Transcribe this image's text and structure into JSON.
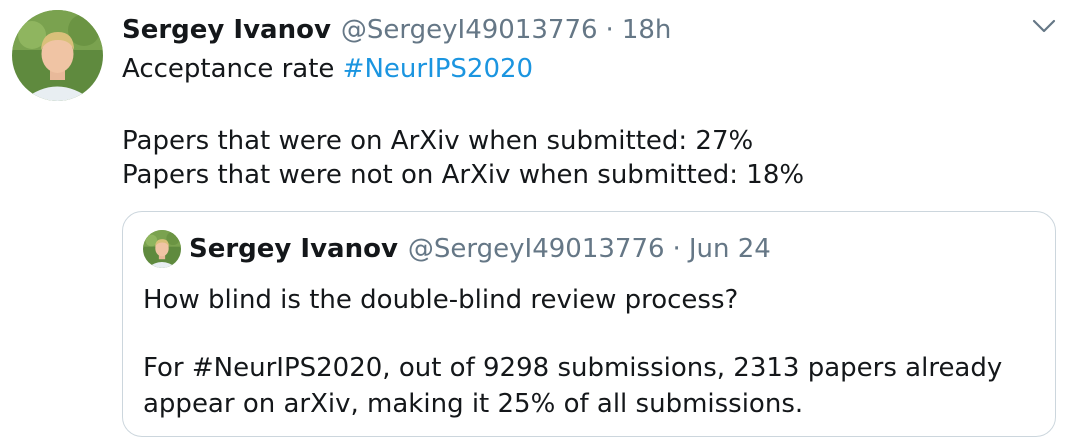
{
  "tweet": {
    "author_name": "Sergey Ivanov",
    "author_handle": "@SergeyI49013776",
    "separator": "·",
    "time": "18h",
    "text_line1_prefix": "Acceptance rate ",
    "hashtag": "#NeurIPS2020",
    "text_line2": "Papers that were on ArXiv when submitted: 27%",
    "text_line3": "Papers that were not on ArXiv when submitted: 18%",
    "menu_icon": "chevron-down-icon"
  },
  "quoted_tweet": {
    "author_name": "Sergey Ivanov",
    "author_handle": "@SergeyI49013776",
    "separator": "·",
    "date": "Jun 24",
    "text_line1": "How blind is the double-blind review process?",
    "text_line2": "For #NeurIPS2020, out of 9298 submissions, 2313 papers already",
    "text_line3": "appear on arXiv, making it 25% of all submissions."
  },
  "colors": {
    "link": "#1b95e0",
    "secondary_text": "#657786",
    "primary_text": "#14171a",
    "border": "#ccd6dd"
  }
}
